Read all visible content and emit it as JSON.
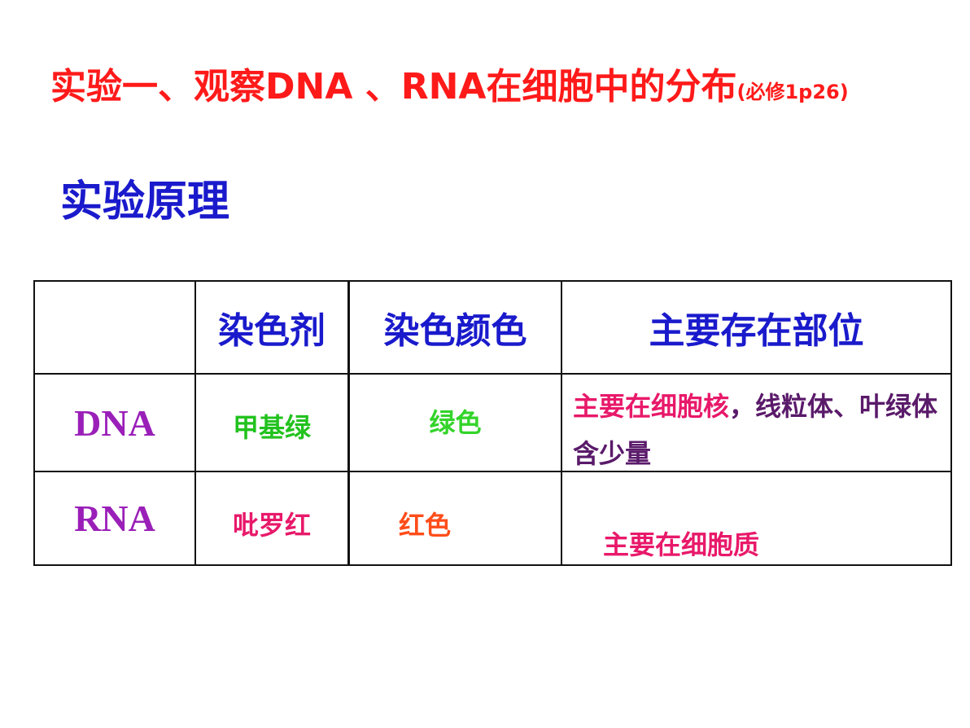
{
  "heading": {
    "title": "实验一、观察DNA 、RNA在细胞中的分布",
    "reference": "(必修1p26)",
    "section": "实验原理"
  },
  "table": {
    "headers": [
      "",
      "染色剂",
      "染色颜色",
      "主要存在部位"
    ],
    "rows": [
      {
        "label": "DNA",
        "stain": "甲基绿",
        "color": "绿色",
        "location_main": "主要在细胞核",
        "location_rest": "，线粒体、叶绿体含少量"
      },
      {
        "label": "RNA",
        "stain": "吡罗红",
        "color": "红色",
        "location": "主要在细胞质"
      }
    ]
  },
  "colors": {
    "title": "#ff1a1a",
    "section": "#1a1acc",
    "row_label": "#9a1fb8",
    "green": "#22c21e",
    "green_light": "#33d42a",
    "pink": "#e8196a",
    "orange": "#ff4d1a",
    "purple": "#5a1a6a"
  }
}
